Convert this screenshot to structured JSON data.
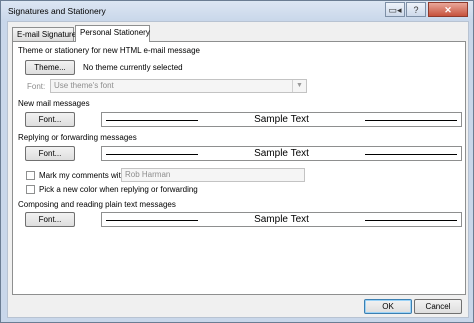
{
  "window": {
    "title": "Signatures and Stationery",
    "sys_icon": "▭◂",
    "help_icon": "?",
    "close_icon": "✕"
  },
  "tabs": [
    {
      "label": "E-mail Signature"
    },
    {
      "label": "Personal Stationery"
    }
  ],
  "theme_section": {
    "label": "Theme or stationery for new HTML e-mail message",
    "button": "Theme...",
    "status": "No theme currently selected",
    "font_label": "Font:",
    "font_value": "Use theme's font"
  },
  "new_mail": {
    "label": "New mail messages",
    "button": "Font...",
    "sample": "Sample Text"
  },
  "reply_forward": {
    "label": "Replying or forwarding messages",
    "button": "Font...",
    "sample": "Sample Text",
    "mark_comments_label": "Mark my comments with:",
    "mark_comments_checked": false,
    "mark_comments_value": "Rob Harman",
    "new_color_label": "Pick a new color when replying or forwarding",
    "new_color_checked": false
  },
  "plain_text": {
    "label": "Composing and reading plain text messages",
    "button": "Font...",
    "sample": "Sample Text"
  },
  "buttons": {
    "ok": "OK",
    "cancel": "Cancel"
  }
}
